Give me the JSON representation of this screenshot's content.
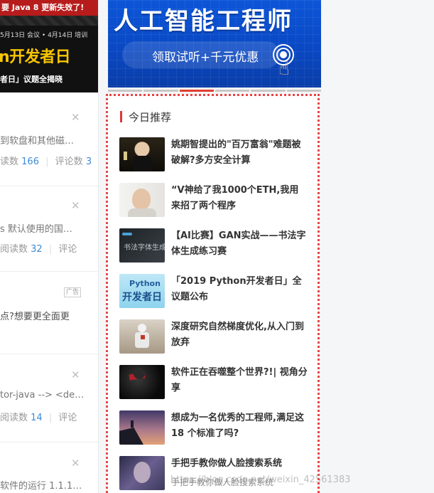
{
  "left_feed": {
    "banner": {
      "top_text": "要 Java 8 更新失效了!",
      "date_text": "5月13日 会议 • 4月14日 培训",
      "title": "n开发者日",
      "subtitle": "者日」议题全揭晓"
    },
    "items": [
      {
        "text": "到软盘和其他磁…",
        "meta_read_label": "读数",
        "meta_read": "166",
        "meta_comment_label": "评论数",
        "meta_comment": "3"
      },
      {
        "text": "s 默认使用的国…",
        "meta_read_label": "阅读数",
        "meta_read": "32",
        "meta_comment_label": "评论",
        "meta_comment": ""
      },
      {
        "ad_tag": "广告",
        "text": "点?想要更全面更"
      },
      {
        "text": "tor-java --> <de…",
        "meta_read_label": "阅读数",
        "meta_read": "14",
        "meta_comment_label": "评论",
        "meta_comment": ""
      },
      {
        "text": "软件的运行 1.1.1…"
      }
    ]
  },
  "ad_banner": {
    "title": "人工智能工程师",
    "subtitle": "领取试听+千元优惠"
  },
  "carousel": {
    "count": 6,
    "active_index": 2
  },
  "recommend": {
    "title": "今日推荐",
    "items": [
      {
        "title": "姚期智提出的\"百万富翁\"难题被破解?多方安全计算",
        "thumb": "man-toasting-photo"
      },
      {
        "title": "“V神给了我1000个ETH,我用来招了两个程序",
        "thumb": "man-portrait-photo"
      },
      {
        "title": "【AI比赛】GAN实战——书法字体生成练习赛",
        "thumb": "calligraphy-font-generation",
        "thumb_label": "书法字体生成"
      },
      {
        "title": "「2019 Python开发者日」全议题公布",
        "thumb": "python-developer-day-logo",
        "thumb_label_1": "Python",
        "thumb_label_2": "开发者日"
      },
      {
        "title": "深度研究自然梯度优化,从入门到放弃",
        "thumb": "robot-figure-photo"
      },
      {
        "title": "软件正在吞噬整个世界?!| 视角分享",
        "thumb": "dark-figure-photo"
      },
      {
        "title": "想成为一名优秀的工程师,满足这 18 个标准了吗?",
        "thumb": "climber-sunset-photo"
      },
      {
        "title": "手把手教你做人脸搜索系统",
        "thumb": "face-mosaic-photo"
      }
    ],
    "partial_item_text": "手把手教你做人脸搜索系统"
  },
  "watermark": "https://blog.csdn.net/weixin_42561383",
  "colors": {
    "accent": "#e33e33",
    "link": "#3e8ad6",
    "ad_blue": "#0c56d8"
  }
}
